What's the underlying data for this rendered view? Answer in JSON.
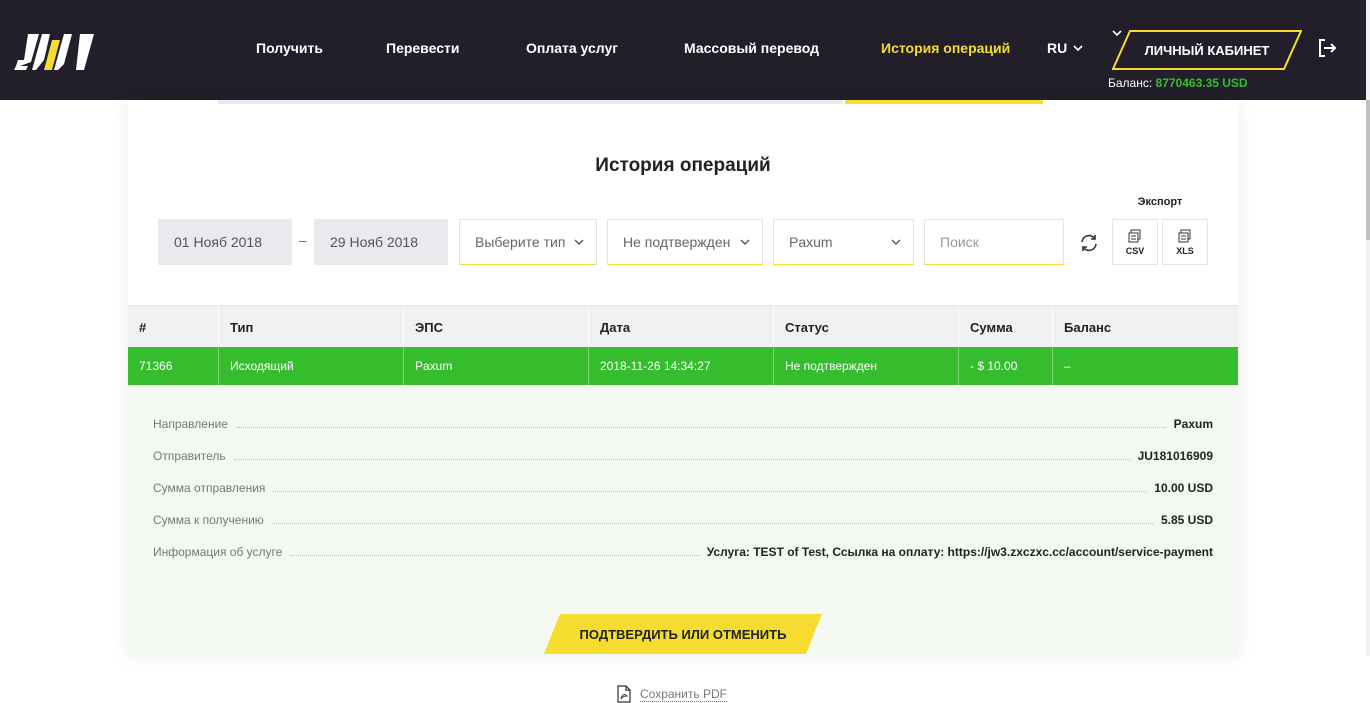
{
  "nav": {
    "items": [
      "Получить",
      "Перевести",
      "Оплата услуг",
      "Массовый перевод",
      "История операций"
    ],
    "language": "RU",
    "cabinet_label": "ЛИЧНЫЙ КАБИНЕТ",
    "balance_label": "Баланс:",
    "balance_value": "8770463.35 USD"
  },
  "page": {
    "title": "История операций"
  },
  "filters": {
    "date_from": "01 Нояб 2018",
    "date_separator": "–",
    "date_to": "29 Нояб 2018",
    "type_select": "Выберите тип",
    "status_select": "Не подтвержден",
    "eps_select": "Paxum",
    "search_placeholder": "Поиск",
    "export_label": "Экспорт",
    "export_csv": "CSV",
    "export_xls": "XLS"
  },
  "table": {
    "headers": [
      "#",
      "Тип",
      "ЭПС",
      "Дата",
      "Статус",
      "Сумма",
      "Баланс"
    ],
    "row": [
      "71366",
      "Исходящий",
      "Paxum",
      "2018-11-26 14:34:27",
      "Не подтвержден",
      "- $ 10.00",
      "–"
    ]
  },
  "details": [
    {
      "label": "Направление",
      "value": "Paxum"
    },
    {
      "label": "Отправитель",
      "value": "JU181016909"
    },
    {
      "label": "Сумма отправления",
      "value": "10.00 USD"
    },
    {
      "label": "Сумма к получению",
      "value": "5.85 USD"
    },
    {
      "label": "Информация об услуге",
      "value": "Услуга: TEST of Test, Ссылка на оплату: https://jw3.zxczxc.cc/account/service-payment"
    }
  ],
  "actions": {
    "save_pdf": "Сохранить PDF",
    "confirm_cancel": "ПОДТВЕРДИТЬ ИЛИ ОТМЕНИТЬ"
  },
  "colors": {
    "header_bg": "#231f2a",
    "accent_yellow": "#f5dc2f",
    "success_green": "#35bd2e",
    "details_bg": "#f3f8f1"
  }
}
